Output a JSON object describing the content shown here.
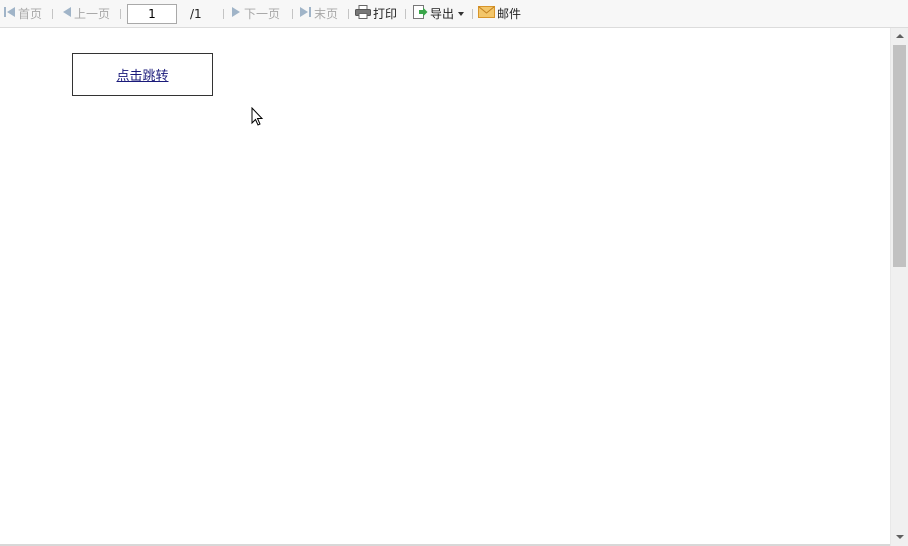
{
  "toolbar": {
    "first_label": "首页",
    "prev_label": "上一页",
    "page_value": "1",
    "page_total": "/1",
    "next_label": "下一页",
    "last_label": "末页",
    "print_label": "打印",
    "export_label": "导出",
    "mail_label": "邮件"
  },
  "content": {
    "jump_link": "点击跳转"
  },
  "colors": {
    "disabled_text": "#a8a8a8",
    "nav_icon_disabled": "#a0b4c8",
    "export_icon_green": "#3aa64a",
    "mail_icon_orange": "#e8a33a",
    "link": "#1a1a7a"
  }
}
